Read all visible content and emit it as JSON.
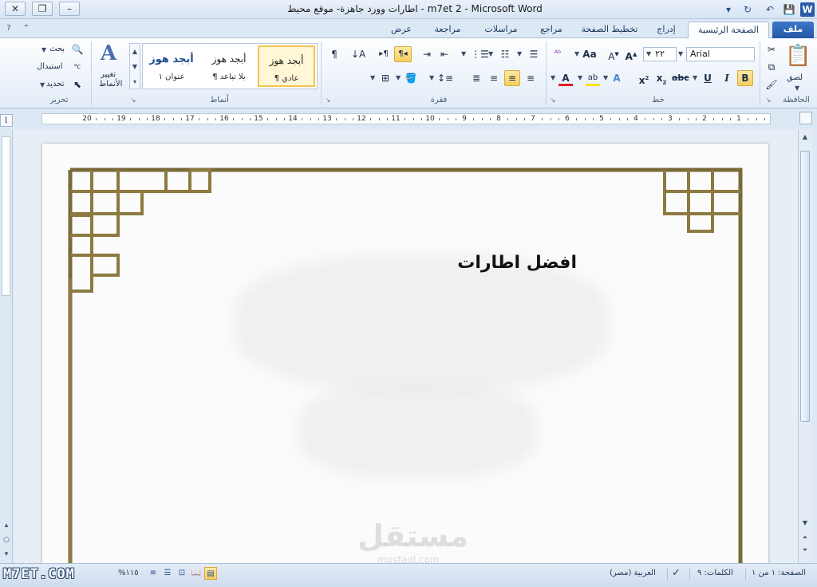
{
  "window": {
    "title": "اطارات وورد جاهزة- موقع محيط - m7et 2  -  Microsoft Word",
    "minimize_icon": "minimize-icon",
    "restore_icon": "restore-icon",
    "close_icon": "close-icon"
  },
  "tabs": [
    {
      "label": "ملف"
    },
    {
      "label": "الصفحة الرئيسية"
    },
    {
      "label": "إدراج"
    },
    {
      "label": "تخطيط الصفحة"
    },
    {
      "label": "مراجع"
    },
    {
      "label": "مراسلات"
    },
    {
      "label": "مراجعة"
    },
    {
      "label": "عرض"
    }
  ],
  "ribbon": {
    "groups": {
      "clipboard": "الحافظة",
      "font": "خط",
      "paragraph": "فقرة",
      "styles": "أنماط",
      "editing": "تحرير"
    },
    "paste_label": "لصق",
    "font_name": "Arial",
    "font_size": "٢٢",
    "styles": [
      {
        "preview": "أبجد هوز",
        "name": "¶ عادي"
      },
      {
        "preview": "أبجد هوز",
        "name": "¶ بلا تباعد"
      },
      {
        "preview": "أبجد هوز",
        "name": "عنوان ١"
      }
    ],
    "change_styles_label_1": "تغيير",
    "change_styles_label_2": "الأنماط",
    "find_label": "بحث",
    "replace_label": "استبدال",
    "select_label": "تحديد"
  },
  "document": {
    "heading": "افضل اطارات"
  },
  "watermark": {
    "main": "مستقل",
    "sub": "mostaql.com"
  },
  "status": {
    "page": "الصفحة: ١ من ١",
    "words": "الكلمات: ٩",
    "language": "العربية (مصر)",
    "zoom": "%١١٥",
    "brand": "M7ET.COM"
  },
  "ruler_numbers": [
    "1",
    "2",
    "3",
    "4",
    "5",
    "6",
    "7",
    "8",
    "9",
    "10",
    "11",
    "12",
    "13",
    "14",
    "15",
    "16",
    "17",
    "18",
    "19",
    "20"
  ]
}
